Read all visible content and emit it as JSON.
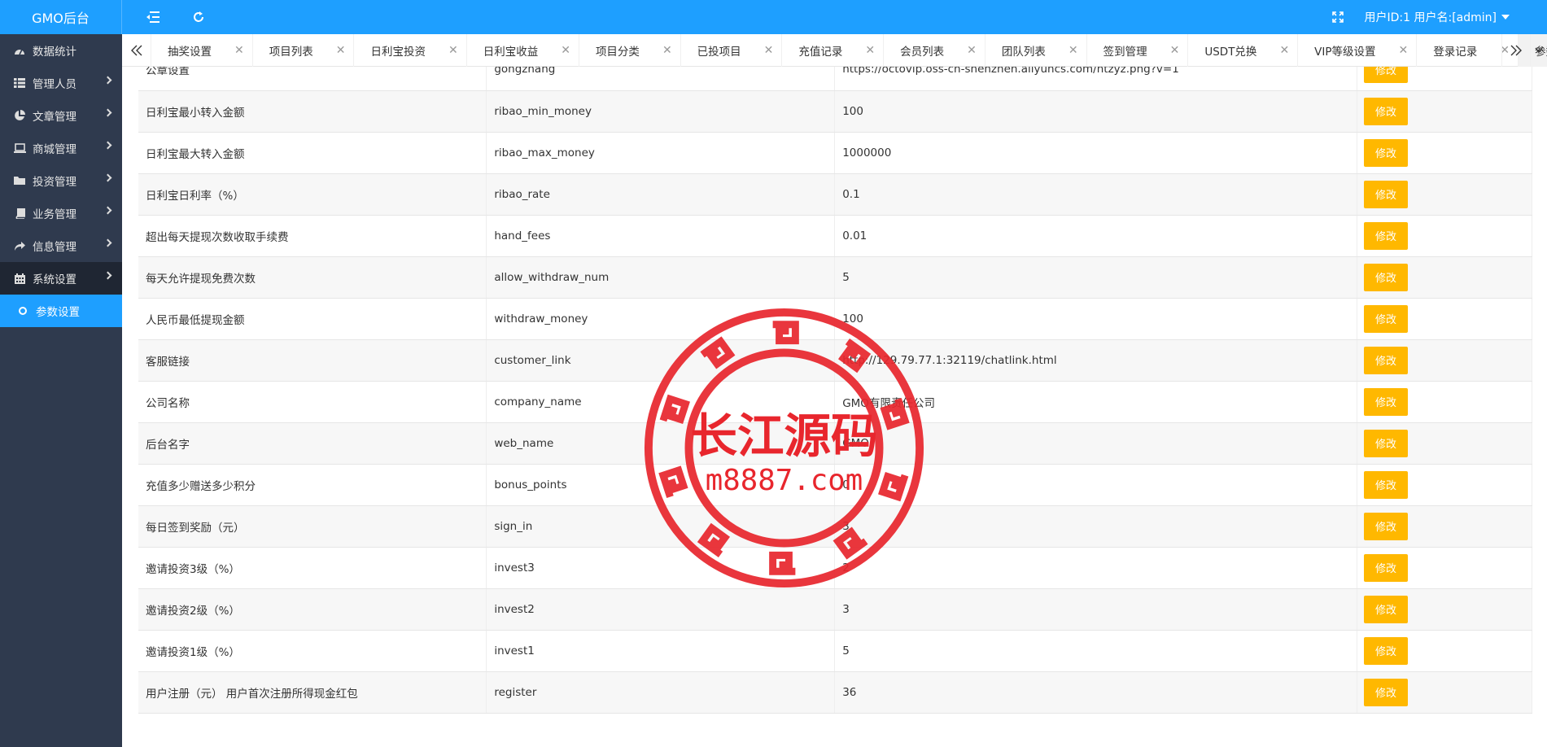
{
  "app": {
    "logo": "GMO后台",
    "user_label": "用户ID:1 用户名:[admin]"
  },
  "sidebar": {
    "items": [
      {
        "label": "数据统计",
        "icon": "dashboard-icon"
      },
      {
        "label": "管理人员",
        "icon": "grid-icon"
      },
      {
        "label": "文章管理",
        "icon": "pie-chart-icon"
      },
      {
        "label": "商城管理",
        "icon": "laptop-icon"
      },
      {
        "label": "投资管理",
        "icon": "folder-icon"
      },
      {
        "label": "业务管理",
        "icon": "book-icon"
      },
      {
        "label": "信息管理",
        "icon": "share-icon"
      },
      {
        "label": "系统设置",
        "icon": "calendar-icon"
      }
    ],
    "sub_item": {
      "label": "参数设置"
    }
  },
  "tabs": [
    {
      "label": "抽奖设置"
    },
    {
      "label": "项目列表"
    },
    {
      "label": "日利宝投资"
    },
    {
      "label": "日利宝收益"
    },
    {
      "label": "项目分类"
    },
    {
      "label": "已投项目"
    },
    {
      "label": "充值记录"
    },
    {
      "label": "会员列表"
    },
    {
      "label": "团队列表"
    },
    {
      "label": "签到管理"
    },
    {
      "label": "USDT兑换"
    },
    {
      "label": "VIP等级设置"
    },
    {
      "label": "登录记录"
    },
    {
      "label": "参数设置"
    }
  ],
  "table": {
    "edit_label": "修改",
    "rows": [
      {
        "name": "公章设置",
        "key": "gongzhang",
        "value": "https://octovip.oss-cn-shenzhen.aliyuncs.com/htzyz.png?v=1"
      },
      {
        "name": "日利宝最小转入金额",
        "key": "ribao_min_money",
        "value": "100"
      },
      {
        "name": "日利宝最大转入金额",
        "key": "ribao_max_money",
        "value": "1000000"
      },
      {
        "name": "日利宝日利率（%）",
        "key": "ribao_rate",
        "value": "0.1"
      },
      {
        "name": "超出每天提现次数收取手续费",
        "key": "hand_fees",
        "value": "0.01"
      },
      {
        "name": "每天允许提现免费次数",
        "key": "allow_withdraw_num",
        "value": "5"
      },
      {
        "name": "人民币最低提现金额",
        "key": "withdraw_money",
        "value": "100"
      },
      {
        "name": "客服链接",
        "key": "customer_link",
        "value": "http://129.79.77.1:32119/chatlink.html"
      },
      {
        "name": "公司名称",
        "key": "company_name",
        "value": "GMO有限责任公司"
      },
      {
        "name": "后台名字",
        "key": "web_name",
        "value": "GMO"
      },
      {
        "name": "充值多少赠送多少积分",
        "key": "bonus_points",
        "value": "0"
      },
      {
        "name": "每日签到奖励（元）",
        "key": "sign_in",
        "value": "3"
      },
      {
        "name": "邀请投资3级（%）",
        "key": "invest3",
        "value": "2"
      },
      {
        "name": "邀请投资2级（%）",
        "key": "invest2",
        "value": "3"
      },
      {
        "name": "邀请投资1级（%）",
        "key": "invest1",
        "value": "5"
      },
      {
        "name": "用户注册（元） 用户首次注册所得现金红包",
        "key": "register",
        "value": "36"
      }
    ]
  },
  "watermark": {
    "line1": "长江源码",
    "line2": "m8887.com",
    "color": "#e8262d"
  },
  "colors": {
    "primary": "#1e9fff",
    "sidebar": "#2f3a4e",
    "edit_button": "#ffb800"
  }
}
